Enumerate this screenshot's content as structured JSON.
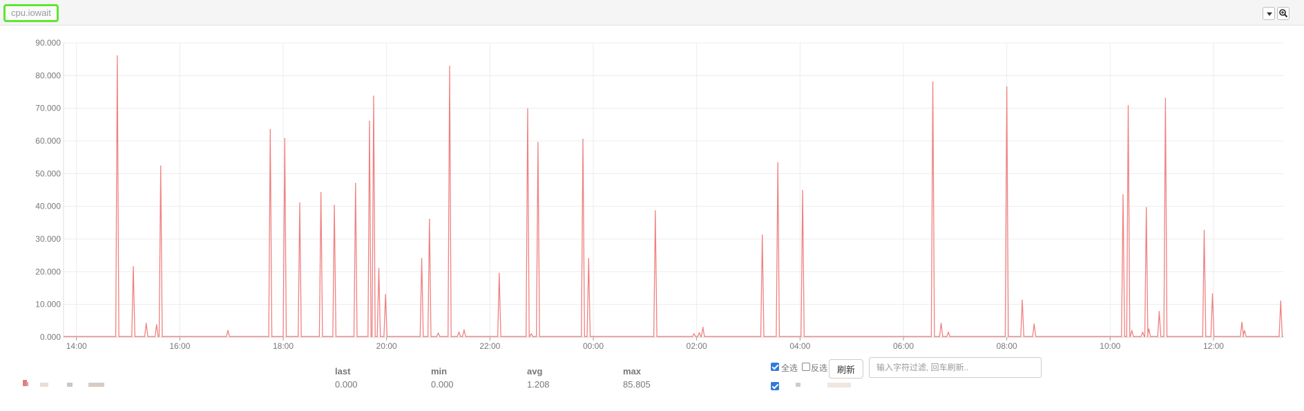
{
  "header": {
    "metric_name": "cpu.iowait"
  },
  "colors": {
    "series": "#f08080",
    "grid": "#ececec",
    "header_highlight": "#5fe62e",
    "checkbox": "#2f7bd8"
  },
  "icons": [
    "caret-down-icon",
    "zoom-in-icon"
  ],
  "chart_data": {
    "type": "line",
    "title": "",
    "xlabel": "",
    "ylabel": "",
    "xlim_hours": [
      13.75,
      37.35
    ],
    "ylim": [
      0,
      90
    ],
    "grid": true,
    "yticks": [
      "0.000",
      "10.000",
      "20.000",
      "30.000",
      "40.000",
      "50.000",
      "60.000",
      "70.000",
      "80.000",
      "90.000"
    ],
    "xticks": [
      {
        "label": "14:00",
        "hour": 14
      },
      {
        "label": "16:00",
        "hour": 16
      },
      {
        "label": "18:00",
        "hour": 18
      },
      {
        "label": "20:00",
        "hour": 20
      },
      {
        "label": "22:00",
        "hour": 22
      },
      {
        "label": "00:00",
        "hour": 24
      },
      {
        "label": "02:00",
        "hour": 26
      },
      {
        "label": "04:00",
        "hour": 28
      },
      {
        "label": "06:00",
        "hour": 30
      },
      {
        "label": "08:00",
        "hour": 32
      },
      {
        "label": "10:00",
        "hour": 34
      },
      {
        "label": "12:00",
        "hour": 36
      }
    ],
    "series": [
      {
        "color": "#f08080",
        "baseline": 0.2,
        "spikes": [
          [
            14.79,
            86.0
          ],
          [
            15.1,
            21.5
          ],
          [
            15.35,
            4.2
          ],
          [
            15.55,
            3.8
          ],
          [
            15.63,
            52.3
          ],
          [
            16.93,
            2.0
          ],
          [
            17.75,
            63.5
          ],
          [
            18.03,
            60.7
          ],
          [
            18.32,
            41.0
          ],
          [
            18.73,
            44.2
          ],
          [
            18.99,
            40.3
          ],
          [
            19.4,
            47.0
          ],
          [
            19.67,
            66.0
          ],
          [
            19.75,
            73.7
          ],
          [
            19.85,
            21.0
          ],
          [
            19.98,
            13.0
          ],
          [
            20.68,
            24.0
          ],
          [
            20.83,
            36.0
          ],
          [
            21.0,
            1.2
          ],
          [
            21.22,
            82.8
          ],
          [
            21.4,
            1.5
          ],
          [
            21.5,
            2.2
          ],
          [
            22.18,
            19.5
          ],
          [
            22.73,
            69.8
          ],
          [
            22.8,
            1.0
          ],
          [
            22.93,
            59.5
          ],
          [
            23.8,
            60.5
          ],
          [
            23.91,
            24.0
          ],
          [
            25.2,
            38.6
          ],
          [
            25.95,
            1.0
          ],
          [
            26.05,
            1.3
          ],
          [
            26.12,
            3.0
          ],
          [
            27.27,
            31.2
          ],
          [
            27.57,
            53.3
          ],
          [
            28.05,
            44.8
          ],
          [
            30.57,
            78.0
          ],
          [
            30.73,
            4.2
          ],
          [
            30.87,
            1.5
          ],
          [
            32.0,
            76.5
          ],
          [
            32.3,
            11.3
          ],
          [
            32.53,
            4.0
          ],
          [
            34.25,
            43.5
          ],
          [
            34.35,
            70.8
          ],
          [
            34.42,
            2.0
          ],
          [
            34.63,
            1.5
          ],
          [
            34.7,
            39.6
          ],
          [
            34.75,
            2.5
          ],
          [
            34.95,
            7.8
          ],
          [
            35.07,
            73.0
          ],
          [
            35.82,
            32.6
          ],
          [
            35.98,
            13.2
          ],
          [
            36.55,
            4.5
          ],
          [
            36.6,
            2.0
          ],
          [
            37.3,
            11.0
          ]
        ]
      }
    ]
  },
  "stats": {
    "headers": [
      "last",
      "min",
      "avg",
      "max"
    ],
    "values": [
      "0.000",
      "0.000",
      "1.208",
      "85.805"
    ]
  },
  "controls": {
    "select_all_label": "全选",
    "invert_label": "反选",
    "refresh_label": "刷新",
    "filter_placeholder": "输入字符过滤, 回车刷新.."
  }
}
